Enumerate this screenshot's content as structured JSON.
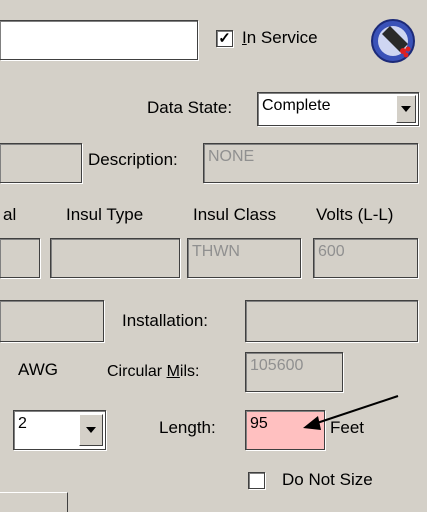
{
  "top": {
    "in_service_label": "In Service",
    "in_service_checked": "✓"
  },
  "data_state": {
    "label": "Data State:",
    "value": "Complete"
  },
  "description": {
    "label": "Description:",
    "value": "NONE"
  },
  "columns": {
    "partial": "al",
    "insul_type": "Insul Type",
    "insul_class": "Insul Class",
    "volts": "Volts (L-L)"
  },
  "insul_class_value": "THWN",
  "volts_value": "600",
  "installation_label": "Installation:",
  "awg_label": "AWG",
  "circular_mils": {
    "label_pre": "Circular ",
    "label_u": "M",
    "label_post": "ils:",
    "value": "105600"
  },
  "size_select_value": "2",
  "length": {
    "label": "Length:",
    "value": "95",
    "unit": "Feet"
  },
  "do_not_size": {
    "label": "Do Not Size"
  }
}
